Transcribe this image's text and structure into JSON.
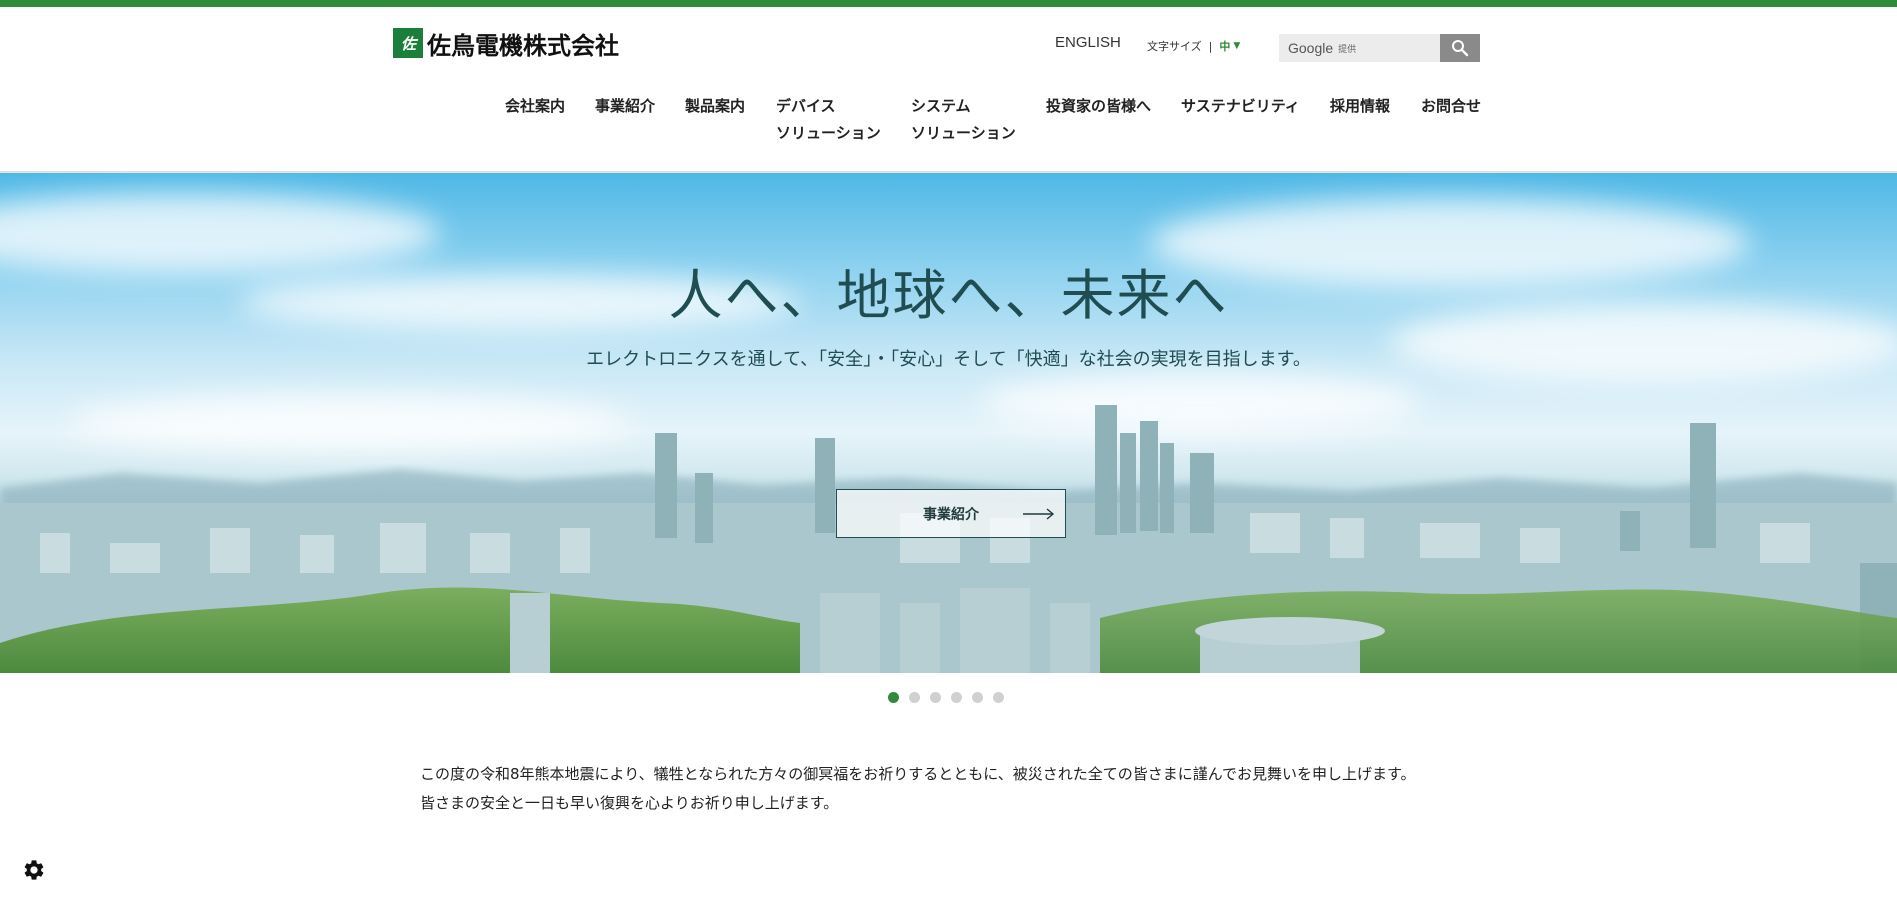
{
  "header": {
    "logo_mark": "佐",
    "logo_text": "佐鳥電機株式会社",
    "english_link": "ENGLISH",
    "font_size": {
      "label": "文字サイズ",
      "separator": "|",
      "current": "中",
      "caret": "▼"
    },
    "search": {
      "provider": "Google",
      "provider_suffix": "提供"
    }
  },
  "nav": {
    "items": [
      {
        "line1": "会社案内",
        "line2": ""
      },
      {
        "line1": "事業紹介",
        "line2": ""
      },
      {
        "line1": "製品案内",
        "line2": ""
      },
      {
        "line1": "デバイス",
        "line2": "ソリューション"
      },
      {
        "line1": "システム",
        "line2": "ソリューション"
      },
      {
        "line1": "投資家の皆様へ",
        "line2": ""
      },
      {
        "line1": "サステナビリティ",
        "line2": ""
      },
      {
        "line1": "採用情報",
        "line2": ""
      },
      {
        "line1": "お問合せ",
        "line2": ""
      }
    ]
  },
  "hero": {
    "title": "人へ、地球へ、未来へ",
    "subtitle": "エレクトロニクスを通して、「安全」・「安心」そして「快適」な社会の実現を目指します。",
    "button_label": "事業紹介"
  },
  "carousel": {
    "slide_count": 6,
    "active_index": 0
  },
  "notice": {
    "line1": "この度の令和8年熊本地震により、犠牲となられた方々の御冥福をお祈りするとともに、被災された全ての皆さまに謹んでお見舞いを申し上げます。",
    "line2": "皆さまの安全と一日も早い復興を心よりお祈り申し上げます。"
  },
  "colors": {
    "brand_green": "#2e8b3a",
    "logo_green": "#1a7f3a",
    "hero_text": "#1f4d52",
    "search_button": "#8a8a8a"
  }
}
